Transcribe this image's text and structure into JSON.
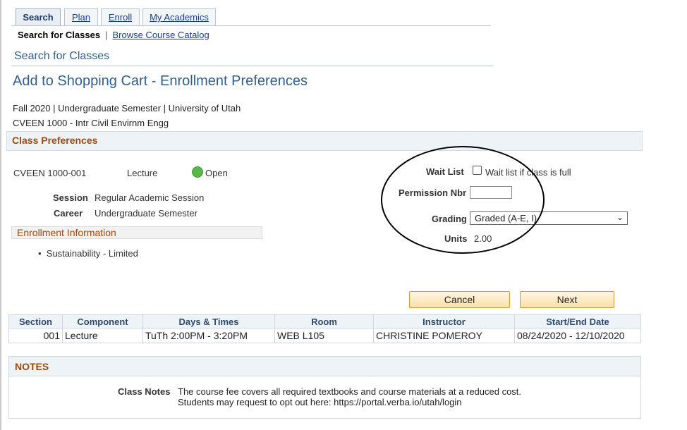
{
  "tabs": [
    {
      "label": "Search",
      "active": true
    },
    {
      "label": "Plan",
      "active": false
    },
    {
      "label": "Enroll",
      "active": false
    },
    {
      "label": "My Academics",
      "active": false
    }
  ],
  "subnav": {
    "current": "Search for Classes",
    "separator": "|",
    "link": "Browse Course Catalog"
  },
  "section_title": "Search for Classes",
  "page_title": "Add to Shopping Cart - Enrollment Preferences",
  "term_line": "Fall 2020 | Undergraduate Semester | University of Utah",
  "course_line": "CVEEN 1000 - Intr Civil Envirnm Engg",
  "class_prefs": {
    "header": "Class Preferences",
    "class_id": "CVEEN 1000-001",
    "component": "Lecture",
    "status": "Open",
    "session_label": "Session",
    "session_value": "Regular Academic Session",
    "career_label": "Career",
    "career_value": "Undergraduate Semester"
  },
  "enrollment_info": {
    "header": "Enrollment Information",
    "items": [
      "Sustainability - Limited"
    ]
  },
  "options": {
    "wait_list_label": "Wait List",
    "wait_list_checkbox_label": "Wait list if class is full",
    "permission_label": "Permission Nbr",
    "permission_value": "",
    "grading_label": "Grading",
    "grading_value": "Graded (A-E, I)",
    "units_label": "Units",
    "units_value": "2.00"
  },
  "buttons": {
    "cancel": "Cancel",
    "next": "Next"
  },
  "section_table": {
    "headers": [
      "Section",
      "Component",
      "Days & Times",
      "Room",
      "Instructor",
      "Start/End Date"
    ],
    "rows": [
      [
        "001",
        "Lecture",
        "TuTh 2:00PM - 3:20PM",
        "WEB L105",
        "CHRISTINE POMEROY",
        "08/24/2020 - 12/10/2020"
      ]
    ]
  },
  "notes": {
    "header": "NOTES",
    "label": "Class Notes",
    "text": "The course fee covers all required textbooks and course materials at a reduced cost. Students may request to opt out here: https://portal.verba.io/utah/login"
  },
  "icons": {
    "status_open": "green-circle-icon",
    "select_arrow": "chevron-down-icon"
  },
  "colors": {
    "link": "#1a3c8e",
    "title": "#2f5f8e",
    "section_header": "#9b4a10",
    "open": "#58b948",
    "button_border": "#d39a3a"
  }
}
